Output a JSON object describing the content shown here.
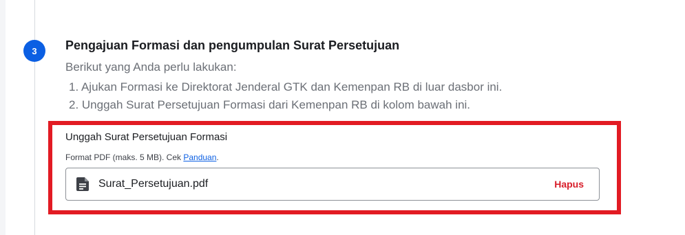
{
  "step": {
    "number": "3",
    "title": "Pengajuan Formasi dan pengumpulan Surat Persetujuan",
    "intro": "Berikut yang Anda perlu lakukan:",
    "items": [
      "1. Ajukan Formasi ke Direktorat Jenderal GTK dan Kemenpan RB di luar dasbor ini.",
      "2. Unggah Surat Persetujuan Formasi dari Kemenpan RB di kolom bawah ini."
    ]
  },
  "upload": {
    "title": "Unggah Surat Persetujuan Formasi",
    "hint_prefix": "Format PDF (maks. 5 MB). Cek ",
    "hint_link": "Panduan",
    "hint_suffix": ".",
    "file_name": "Surat_Persetujuan.pdf",
    "file_icon": "document-icon",
    "remove_label": "Hapus"
  },
  "colors": {
    "accent": "#0b5fe3",
    "highlight": "#e21b23",
    "danger": "#d81e2a"
  }
}
